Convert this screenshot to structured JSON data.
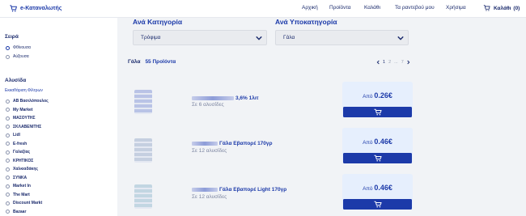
{
  "brand": {
    "name": "e-Καταναλωτής"
  },
  "nav": {
    "links": [
      "Αρχική",
      "Προϊόντα",
      "Καλάθι",
      "Τα ραντεβού μου",
      "Χρήσιμα"
    ],
    "cart_label": "Καλάθι",
    "cart_count": "(0)"
  },
  "sidebar": {
    "sort_title": "Σειρά",
    "sort_options": [
      "Φθίνουσα",
      "Αύξουσα"
    ],
    "sort_selected": "Φθίνουσα",
    "chain_title": "Αλυσίδα",
    "clear_filters": "Εκκαθάριση Φίλτρων",
    "chains": [
      "ΑΒ Βασιλόπουλος",
      "My Market",
      "ΜΑΣΟΥΤΗΣ",
      "ΣΚΛΑΒΕΝΙΤΗΣ",
      "Lidl",
      "E-fresh",
      "Γαλαξίας",
      "ΚΡΗΤΙΚΟΣ",
      "Χαλκιαδάκης",
      "ΣΥΝΚΑ",
      "Market In",
      "The Mart",
      "Discount Markt",
      "Bazaar"
    ]
  },
  "filters": {
    "category_label": "Ανά Κατηγορία",
    "category_value": "Τρόφιμα",
    "subcategory_label": "Ανά Υποκατηγορία",
    "subcategory_value": "Γάλα"
  },
  "results": {
    "breadcrumb": "Γάλα",
    "count": "55 Προϊόντα",
    "pager": {
      "pages": [
        "1",
        "2",
        "...",
        "7"
      ],
      "active": "1"
    }
  },
  "products": [
    {
      "name": "3,6% 1λιτ",
      "stores": "Σε 6 αλυσίδες",
      "price_prefix": "Από",
      "price": "0.26€",
      "thumb_color": "#b9c3e6"
    },
    {
      "name": "Γάλα Εβαπορέ 170γρ",
      "stores": "Σε 12 αλυσίδες",
      "price_prefix": "Από",
      "price": "0.46€",
      "thumb_color": "#c5cfe0"
    },
    {
      "name": "Γάλα Εβαπορέ Light 170γρ",
      "stores": "Σε 12 αλυσίδες",
      "price_prefix": "Από",
      "price": "0.46€",
      "thumb_color": "#c2d6e2"
    }
  ],
  "icons": {
    "brand": "shopping-cart-icon",
    "cart": "shopping-cart-icon",
    "dropdown": "chevron-down-icon",
    "pager_prev": "chevron-left-icon",
    "pager_next": "chevron-right-icon",
    "add": "add-to-cart-icon"
  },
  "colors": {
    "accent": "#1c3aa9",
    "text": "#1a2a6c",
    "price_bg": "#e6effd",
    "page_bg": "#f1f3f6"
  }
}
